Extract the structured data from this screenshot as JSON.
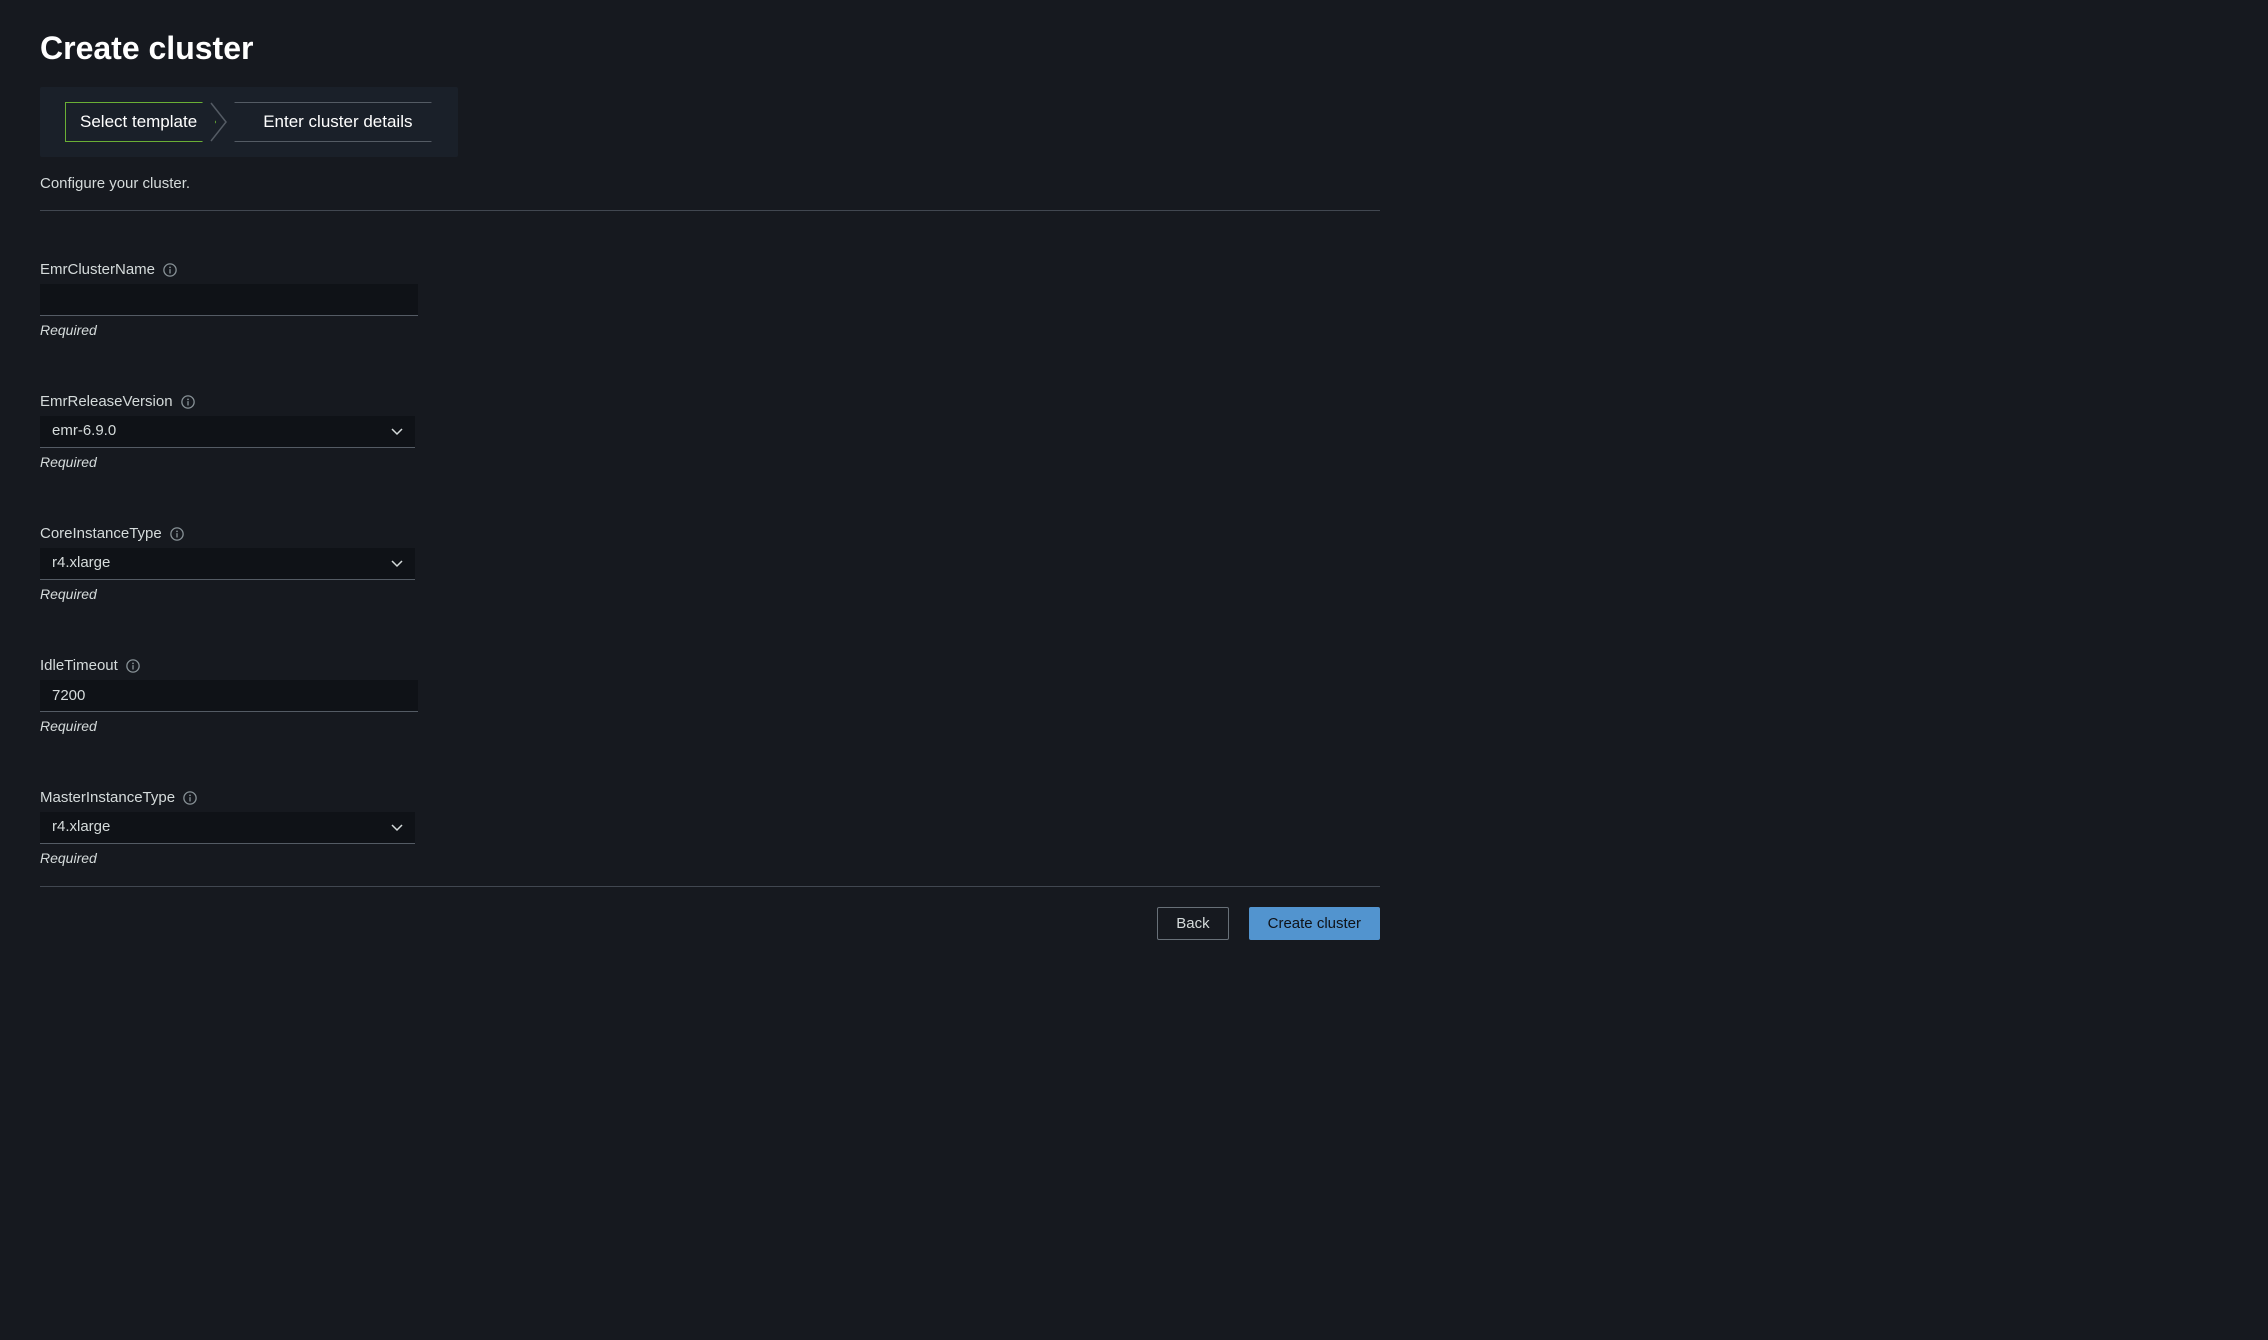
{
  "page": {
    "title": "Create cluster",
    "subtitle": "Configure your cluster."
  },
  "wizard": {
    "step1": "Select template",
    "step2": "Enter cluster details"
  },
  "fields": {
    "cluster_name": {
      "label": "EmrClusterName",
      "value": "",
      "helper": "Required"
    },
    "release_version": {
      "label": "EmrReleaseVersion",
      "value": "emr-6.9.0",
      "helper": "Required"
    },
    "core_instance_type": {
      "label": "CoreInstanceType",
      "value": "r4.xlarge",
      "helper": "Required"
    },
    "idle_timeout": {
      "label": "IdleTimeout",
      "value": "7200",
      "helper": "Required"
    },
    "master_instance_type": {
      "label": "MasterInstanceType",
      "value": "r4.xlarge",
      "helper": "Required"
    }
  },
  "actions": {
    "back": "Back",
    "create": "Create cluster"
  }
}
